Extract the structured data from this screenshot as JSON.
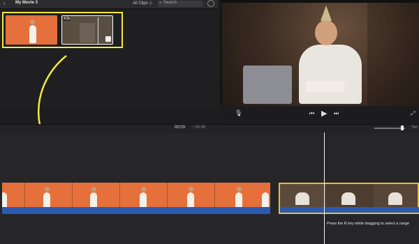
{
  "window": {
    "title": "My Movie 3"
  },
  "browser": {
    "clips_filter": "All Clips ◇",
    "search_placeholder": "Search",
    "clip2_badge": "4.8s"
  },
  "timeline": {
    "current_time": "00:03",
    "total_time": "/ 00:45",
    "settings_label": "Set",
    "hint_text": "Press the R key while dragging to select a range"
  },
  "colors": {
    "selection": "#f5ea3a",
    "arrow": "#f5ea3a",
    "clip_orange": "#e5703b",
    "audio_blue": "#2c59b0"
  },
  "icons": [
    "back-arrow-icon",
    "search-icon",
    "gear-icon",
    "microphone-icon",
    "skip-back-icon",
    "play-icon",
    "skip-forward-icon",
    "fullscreen-icon"
  ]
}
